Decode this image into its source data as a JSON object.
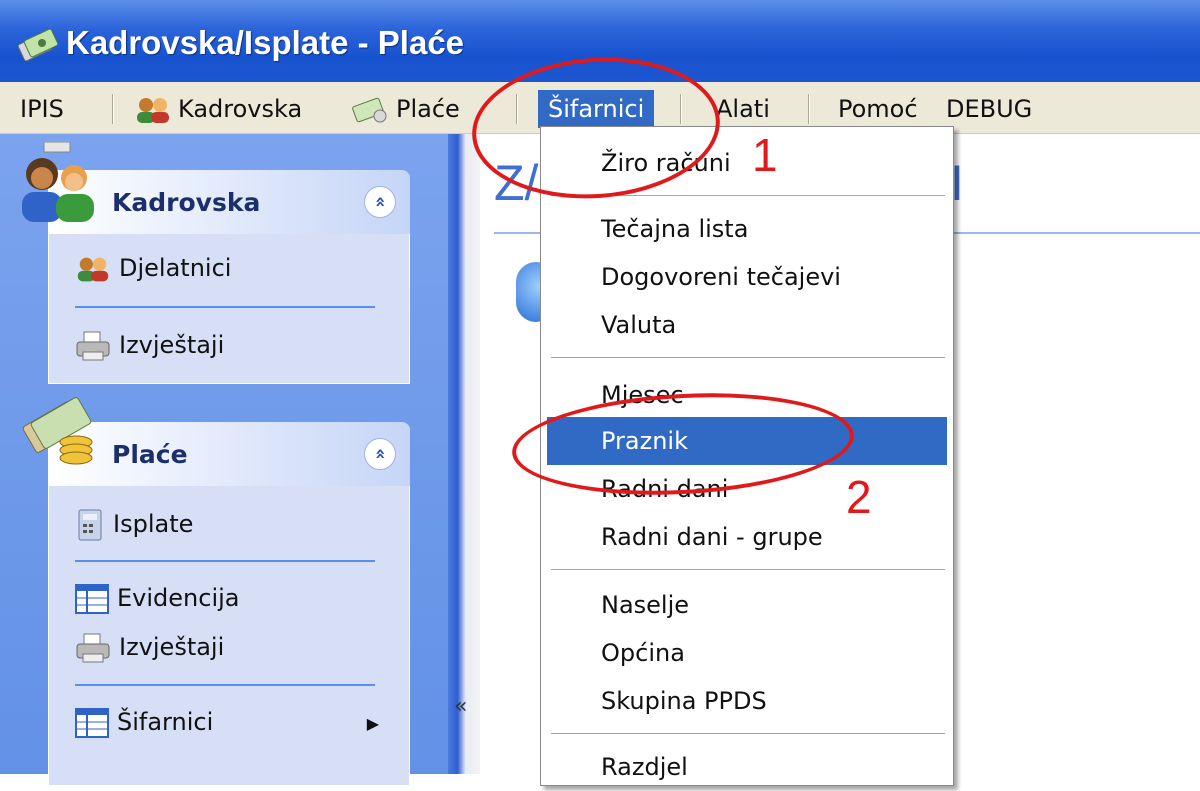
{
  "window": {
    "title": "Kadrovska/Isplate - Plaće",
    "icon": "payroll-app-icon"
  },
  "menubar": {
    "items": [
      {
        "label": "IPIS",
        "icon": null
      },
      {
        "label": "Kadrovska",
        "icon": "users-icon"
      },
      {
        "label": "Plaće",
        "icon": "money-icon"
      },
      {
        "label": "Šifarnici",
        "icon": null,
        "active": true
      },
      {
        "label": "Alati",
        "icon": null
      },
      {
        "label": "Pomoć",
        "icon": null
      },
      {
        "label": "DEBUG",
        "icon": null
      }
    ]
  },
  "leftpane": {
    "groups": [
      {
        "title": "Kadrovska",
        "icon": "people-group-icon",
        "collapse_glyph": "«",
        "items": [
          {
            "label": "Djelatnici",
            "icon": "users-icon"
          },
          {
            "label": "Izvještaji",
            "icon": "printer-icon"
          }
        ]
      },
      {
        "title": "Plaće",
        "icon": "money-coins-icon",
        "collapse_glyph": "«",
        "items": [
          {
            "label": "Isplate",
            "icon": "calculator-icon"
          },
          {
            "label": "Evidencija",
            "icon": "table-icon"
          },
          {
            "label": "Izvještaji",
            "icon": "printer-icon"
          },
          {
            "label": "Šifarnici",
            "icon": "table-icon",
            "submenu": true
          }
        ]
      }
    ],
    "splitter_glyph": "«"
  },
  "content": {
    "heading_left": "Z/",
    "heading_right": "I"
  },
  "dropdown": {
    "items": [
      "Žiro računi",
      "Tečajna lista",
      "Dogovoreni tečajevi",
      "Valuta",
      "Mjesec",
      "Praznik",
      "Radni dani",
      "Radni dani - grupe",
      "Naselje",
      "Općina",
      "Skupina PPDS",
      "Razdjel"
    ],
    "highlighted": "Praznik"
  },
  "annotations": {
    "step1": "1",
    "step2": "2",
    "color": "#e0191b"
  },
  "colors": {
    "titlebar": "#2c64da",
    "menubar": "#ece9d8",
    "highlight": "#316ac5",
    "pane": "#6f9ae9"
  }
}
